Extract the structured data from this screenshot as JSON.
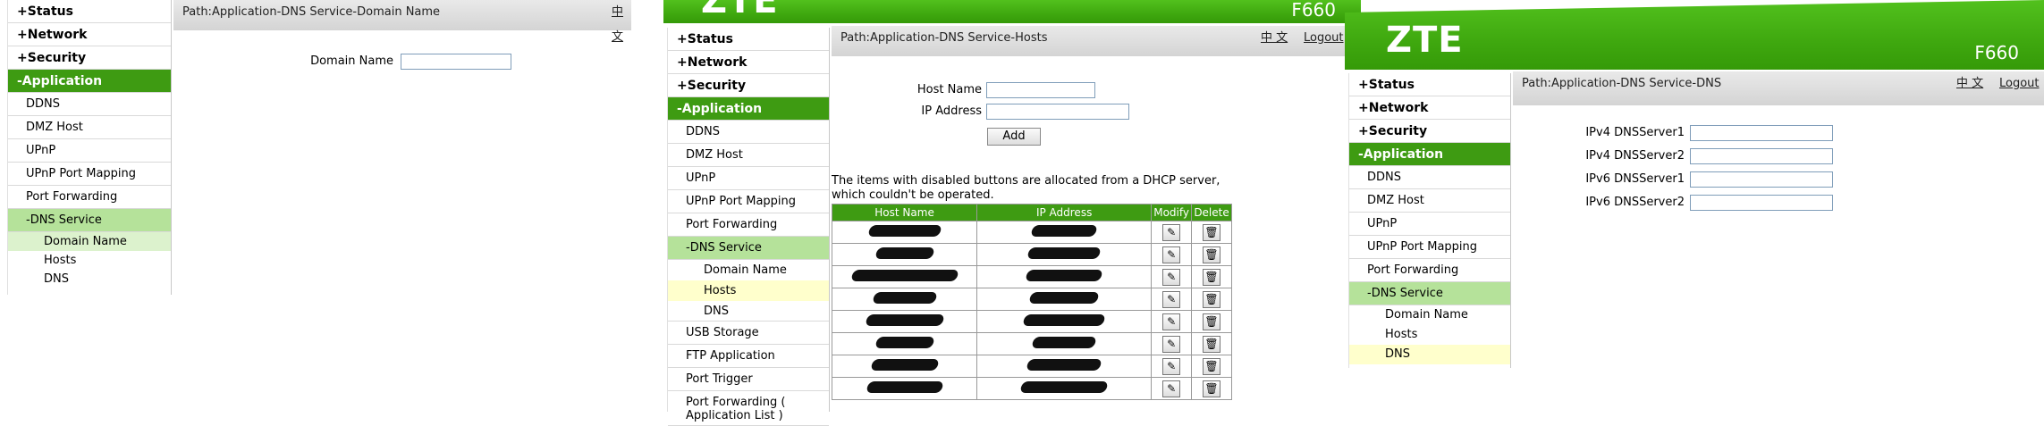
{
  "nav": {
    "status": "Status",
    "network": "Network",
    "security": "Security",
    "application": "-Application",
    "ddns": "DDNS",
    "dmz": "DMZ Host",
    "upnp": "UPnP",
    "upnp_port_mapping": "UPnP Port Mapping",
    "port_forwarding": "Port Forwarding",
    "dns_service": "-DNS Service",
    "domain_name": "Domain Name",
    "hosts": "Hosts",
    "dns": "DNS",
    "usb_storage": "USB Storage",
    "ftp_application": "FTP Application",
    "port_trigger": "Port Trigger",
    "port_forwarding_app_list": "Port Forwarding ( Application List )",
    "plus": "+"
  },
  "header": {
    "brand": "ZTE",
    "model": "F660",
    "lang": "中 文",
    "logout": "Logout"
  },
  "panel1": {
    "path": "Path:Application-DNS Service-Domain Name",
    "domain_label": "Domain Name",
    "domain_value": ""
  },
  "panel2": {
    "path": "Path:Application-DNS Service-Hosts",
    "host_label": "Host Name",
    "ip_label": "IP Address",
    "host_value": "",
    "ip_value": "",
    "add_label": "Add",
    "note": "The items with disabled buttons are allocated from a DHCP server, which couldn't be operated.",
    "table_headers": [
      "Host Name",
      "IP Address",
      "Modify",
      "Delete"
    ],
    "rows": [
      {
        "host": "",
        "ip": ""
      },
      {
        "host": "",
        "ip": ""
      },
      {
        "host": "",
        "ip": ""
      },
      {
        "host": "",
        "ip": ""
      },
      {
        "host": "",
        "ip": ""
      },
      {
        "host": "",
        "ip": ""
      },
      {
        "host": "",
        "ip": ""
      },
      {
        "host": "",
        "ip": ""
      }
    ]
  },
  "panel3": {
    "path": "Path:Application-DNS Service-DNS",
    "ipv4_1": "IPv4 DNSServer1",
    "ipv4_2": "IPv4 DNSServer2",
    "ipv6_1": "IPv6 DNSServer1",
    "ipv6_2": "IPv6 DNSServer2"
  },
  "icons": {
    "modify": "edit-pencil-icon",
    "delete": "trash-can-icon"
  },
  "colors": {
    "banner": "#3fa80f",
    "nav_active": "#3e9b12",
    "dns_service_bg": "#b5e29a",
    "selected_yellow": "#ffffcc"
  }
}
